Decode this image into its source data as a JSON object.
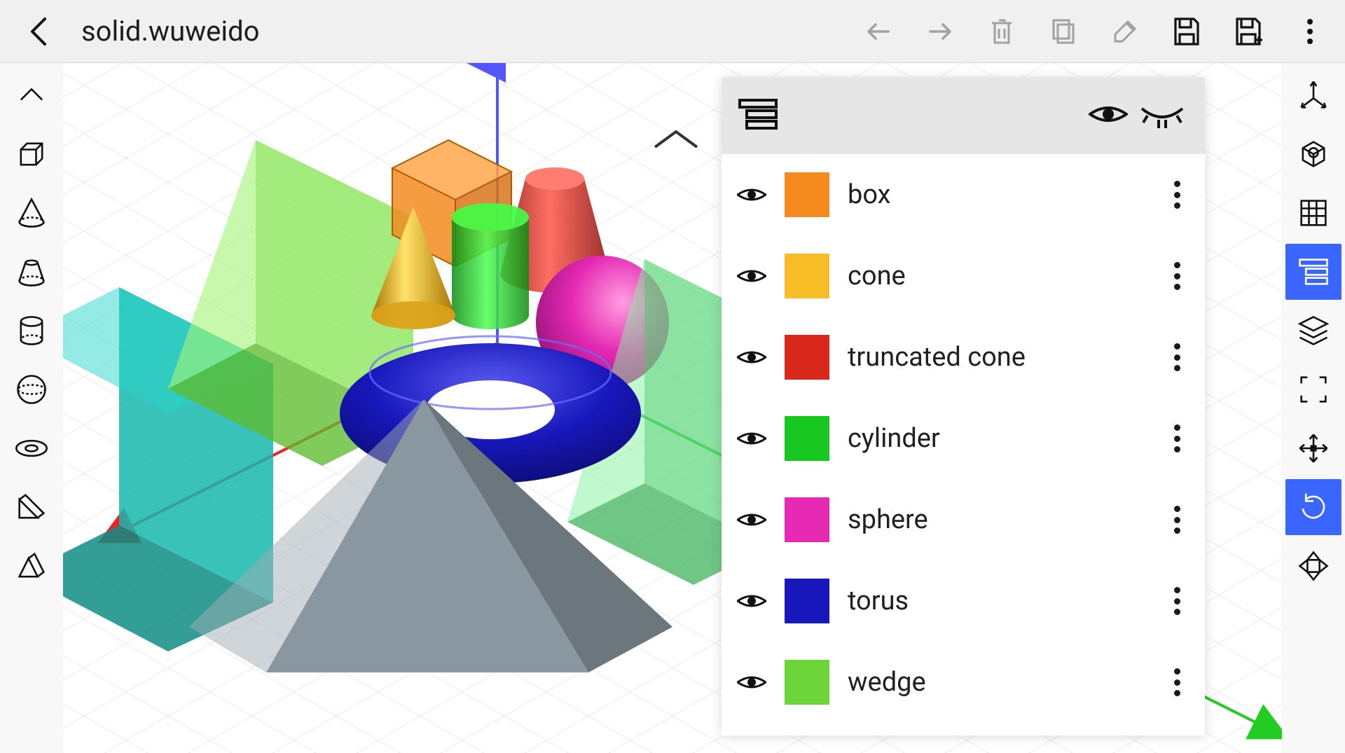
{
  "app": {
    "title": "solid.wuweido"
  },
  "topActions": {
    "back": "Back",
    "undo": "Undo",
    "redo": "Redo",
    "delete": "Delete",
    "copy": "Copy",
    "edit": "Edit",
    "save": "Save",
    "saveAs": "Save As",
    "more": "More"
  },
  "leftTools": {
    "collapse": "Collapse",
    "box": "Box",
    "cone": "Cone",
    "truncatedCone": "Truncated Cone",
    "cylinder": "Cylinder",
    "sphere": "Sphere",
    "torus": "Torus",
    "wedge1": "Wedge",
    "wedge2": "Wedge"
  },
  "rightTools": {
    "axes": "Axes",
    "focus": "Focus",
    "grid": "Grid",
    "objectList": "Object List",
    "layers": "Layers",
    "fullscreen": "Fullscreen",
    "move": "Move",
    "rotate": "Rotate",
    "scale": "Scale"
  },
  "panel": {
    "headerIcon": "object-list-icon",
    "visibleAll": "Show all",
    "hideAll": "Hide all"
  },
  "objects": [
    {
      "label": "box",
      "color": "#f58b1f",
      "visible": true
    },
    {
      "label": "cone",
      "color": "#f6bd27",
      "visible": true
    },
    {
      "label": "truncated cone",
      "color": "#d8281c",
      "visible": true
    },
    {
      "label": "cylinder",
      "color": "#18c71f",
      "visible": true
    },
    {
      "label": "sphere",
      "color": "#e529b3",
      "visible": true
    },
    {
      "label": "torus",
      "color": "#1817bb",
      "visible": true
    },
    {
      "label": "wedge",
      "color": "#6bd53a",
      "visible": true
    }
  ],
  "scene": {
    "axes": {
      "x": "#e22",
      "y": "#2c2",
      "z": "#55f"
    },
    "shapes": {
      "box": {
        "color": "#f58b1f"
      },
      "cone": {
        "color": "#f6bd27"
      },
      "tcone": {
        "color": "#d8281c"
      },
      "cyl": {
        "color": "#18c71f"
      },
      "sphere": {
        "color": "#e529b3"
      },
      "torus": {
        "color": "#1817bb"
      },
      "wedgeL": {
        "color": "#6bd53a"
      },
      "wedgeR": {
        "color": "#3fbf6f"
      },
      "wedgeT": {
        "color": "#16b7ab"
      },
      "pyramid": {
        "color": "#7d8a92"
      }
    }
  }
}
